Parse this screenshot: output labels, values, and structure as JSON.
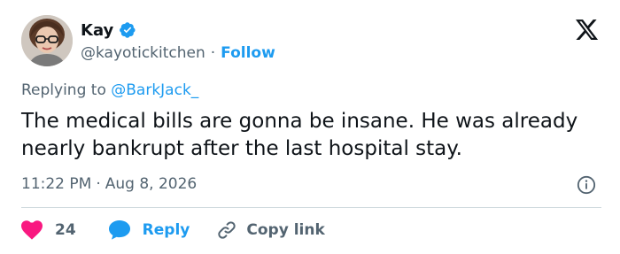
{
  "author": {
    "name": "Kay",
    "handle": "@kayotickitchen",
    "separator": "·",
    "follow_label": "Follow"
  },
  "reply_context": {
    "prefix": "Replying to",
    "mention": "@BarkJack_"
  },
  "tweet": {
    "text": "The medical bills are gonna be insane. He was already nearly bankrupt after the last hospital stay.",
    "time": "11:22 PM",
    "separator": "·",
    "date": "Aug 8, 2026"
  },
  "actions": {
    "like_count": "24",
    "reply_label": "Reply",
    "copy_label": "Copy link"
  },
  "colors": {
    "accent": "#1d9bf0",
    "like": "#f91880",
    "muted": "#536471",
    "text": "#0f1419"
  },
  "icons": [
    "verified-badge-icon",
    "x-logo-icon",
    "info-icon",
    "heart-icon",
    "reply-bubble-icon",
    "link-icon"
  ]
}
